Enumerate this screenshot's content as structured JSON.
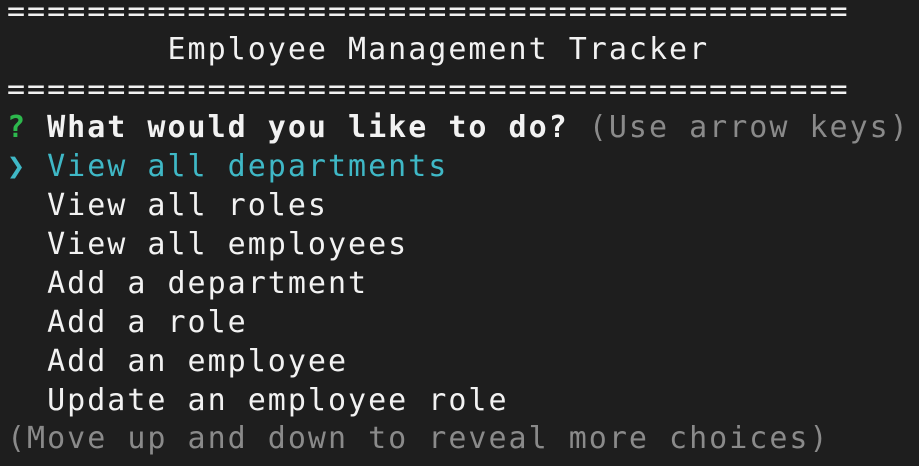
{
  "banner": {
    "rule_top": "==========================================",
    "title": "        Employee Management Tracker",
    "rule_bottom": "=========================================="
  },
  "prompt": {
    "qmark": "?",
    "question": "What would you like to do?",
    "hint": "(Use arrow keys)"
  },
  "menu": {
    "pointer": "❯",
    "choices": [
      "View all departments",
      "View all roles",
      "View all employees",
      "Add a department",
      "Add a role",
      "Add an employee",
      "Update an employee role"
    ],
    "selected_index": 0
  },
  "footer": {
    "hint": "(Move up and down to reveal more choices)"
  },
  "colors": {
    "background": "#1e1e1e",
    "text": "#f2f2f2",
    "selected": "#3fb8c6",
    "question_mark": "#2db84d",
    "dim": "#8a8a8a"
  }
}
